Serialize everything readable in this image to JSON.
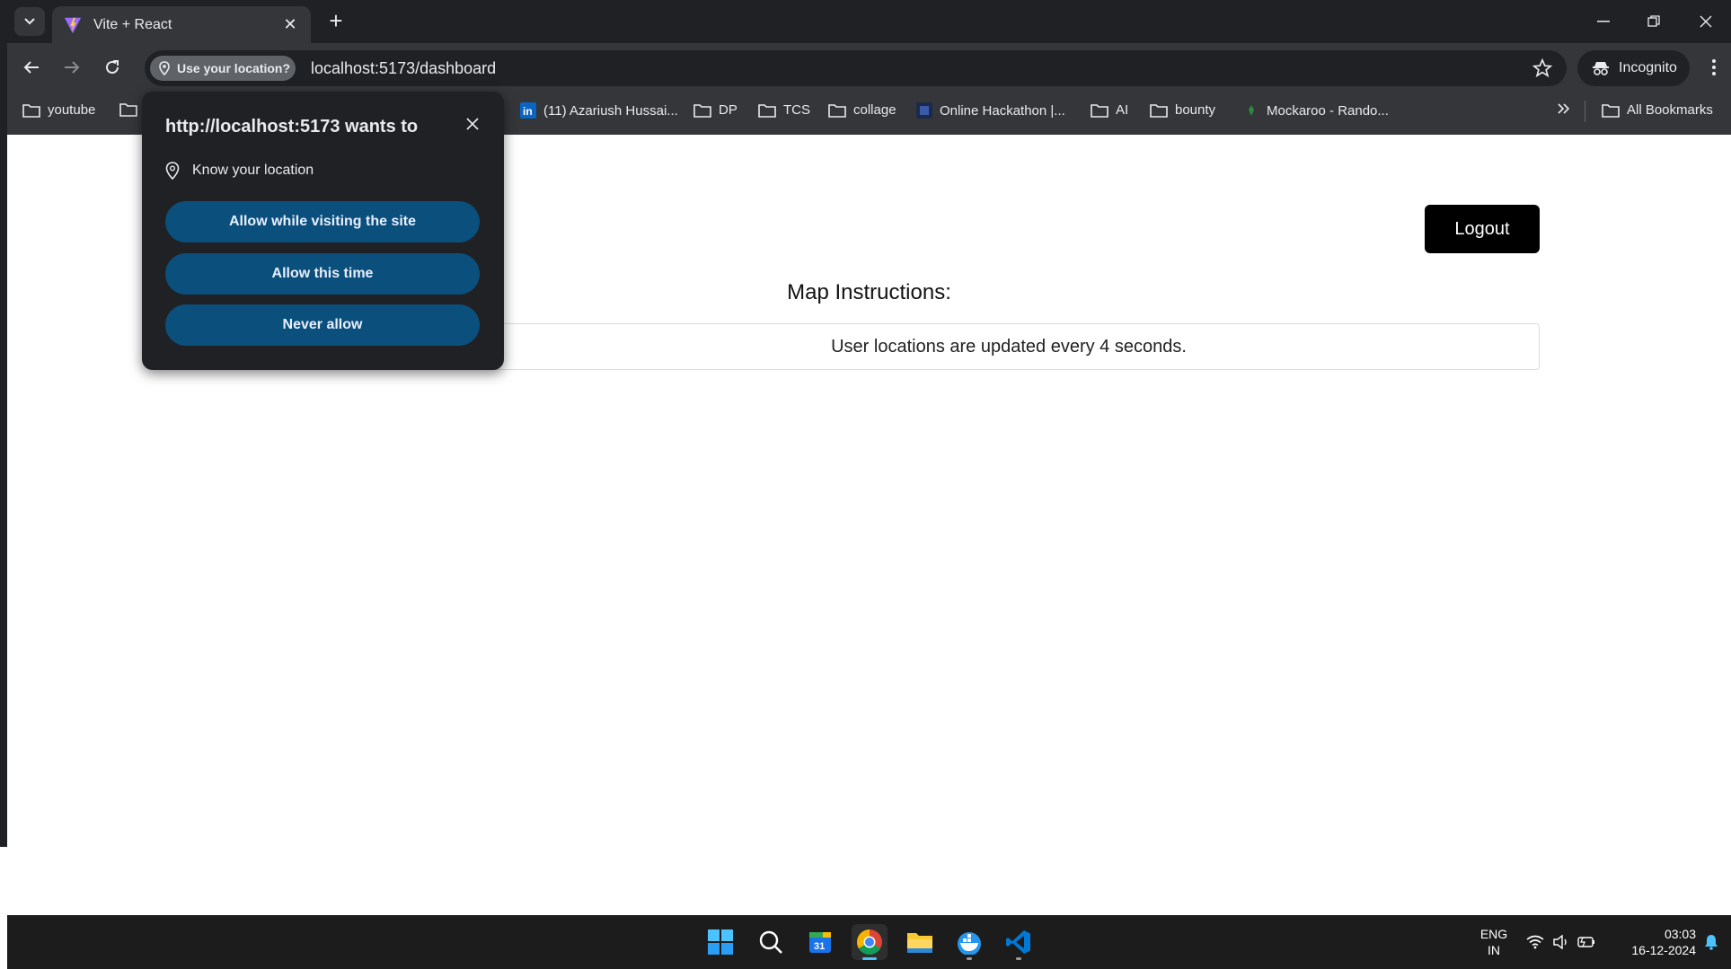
{
  "browser": {
    "tab": {
      "title": "Vite + React"
    },
    "address": {
      "location_chip": "Use your location?",
      "url": "localhost:5173/dashboard"
    },
    "profile": {
      "label": "Incognito"
    },
    "bookmarks": [
      {
        "label": "youtube",
        "icon": "folder-icon"
      },
      {
        "label": "(11) Azariush Hussai...",
        "icon": "linkedin-icon"
      },
      {
        "label": "DP",
        "icon": "folder-icon"
      },
      {
        "label": "TCS",
        "icon": "folder-icon"
      },
      {
        "label": "collage",
        "icon": "folder-icon"
      },
      {
        "label": "Online Hackathon |...",
        "icon": "site-icon"
      },
      {
        "label": "AI",
        "icon": "folder-icon"
      },
      {
        "label": "bounty",
        "icon": "folder-icon"
      },
      {
        "label": "Mockaroo - Rando...",
        "icon": "mockaroo-icon"
      }
    ],
    "all_bookmarks": "All Bookmarks"
  },
  "popup": {
    "title": "http://localhost:5173 wants to",
    "permission": "Know your location",
    "buttons": {
      "allow_visit": "Allow while visiting the site",
      "allow_once": "Allow this time",
      "never": "Never allow"
    }
  },
  "page": {
    "logout_label": "Logout",
    "map_title": "Map Instructions:",
    "map_text": "User locations are updated every 4 seconds."
  },
  "taskbar": {
    "lang_line1": "ENG",
    "lang_line2": "IN",
    "time": "03:03",
    "date": "16-12-2024"
  },
  "colors": {
    "chrome_dark": "#202124",
    "toolbar": "#35363a",
    "popup_button": "#0b4f7c",
    "logout_bg": "#000000"
  }
}
